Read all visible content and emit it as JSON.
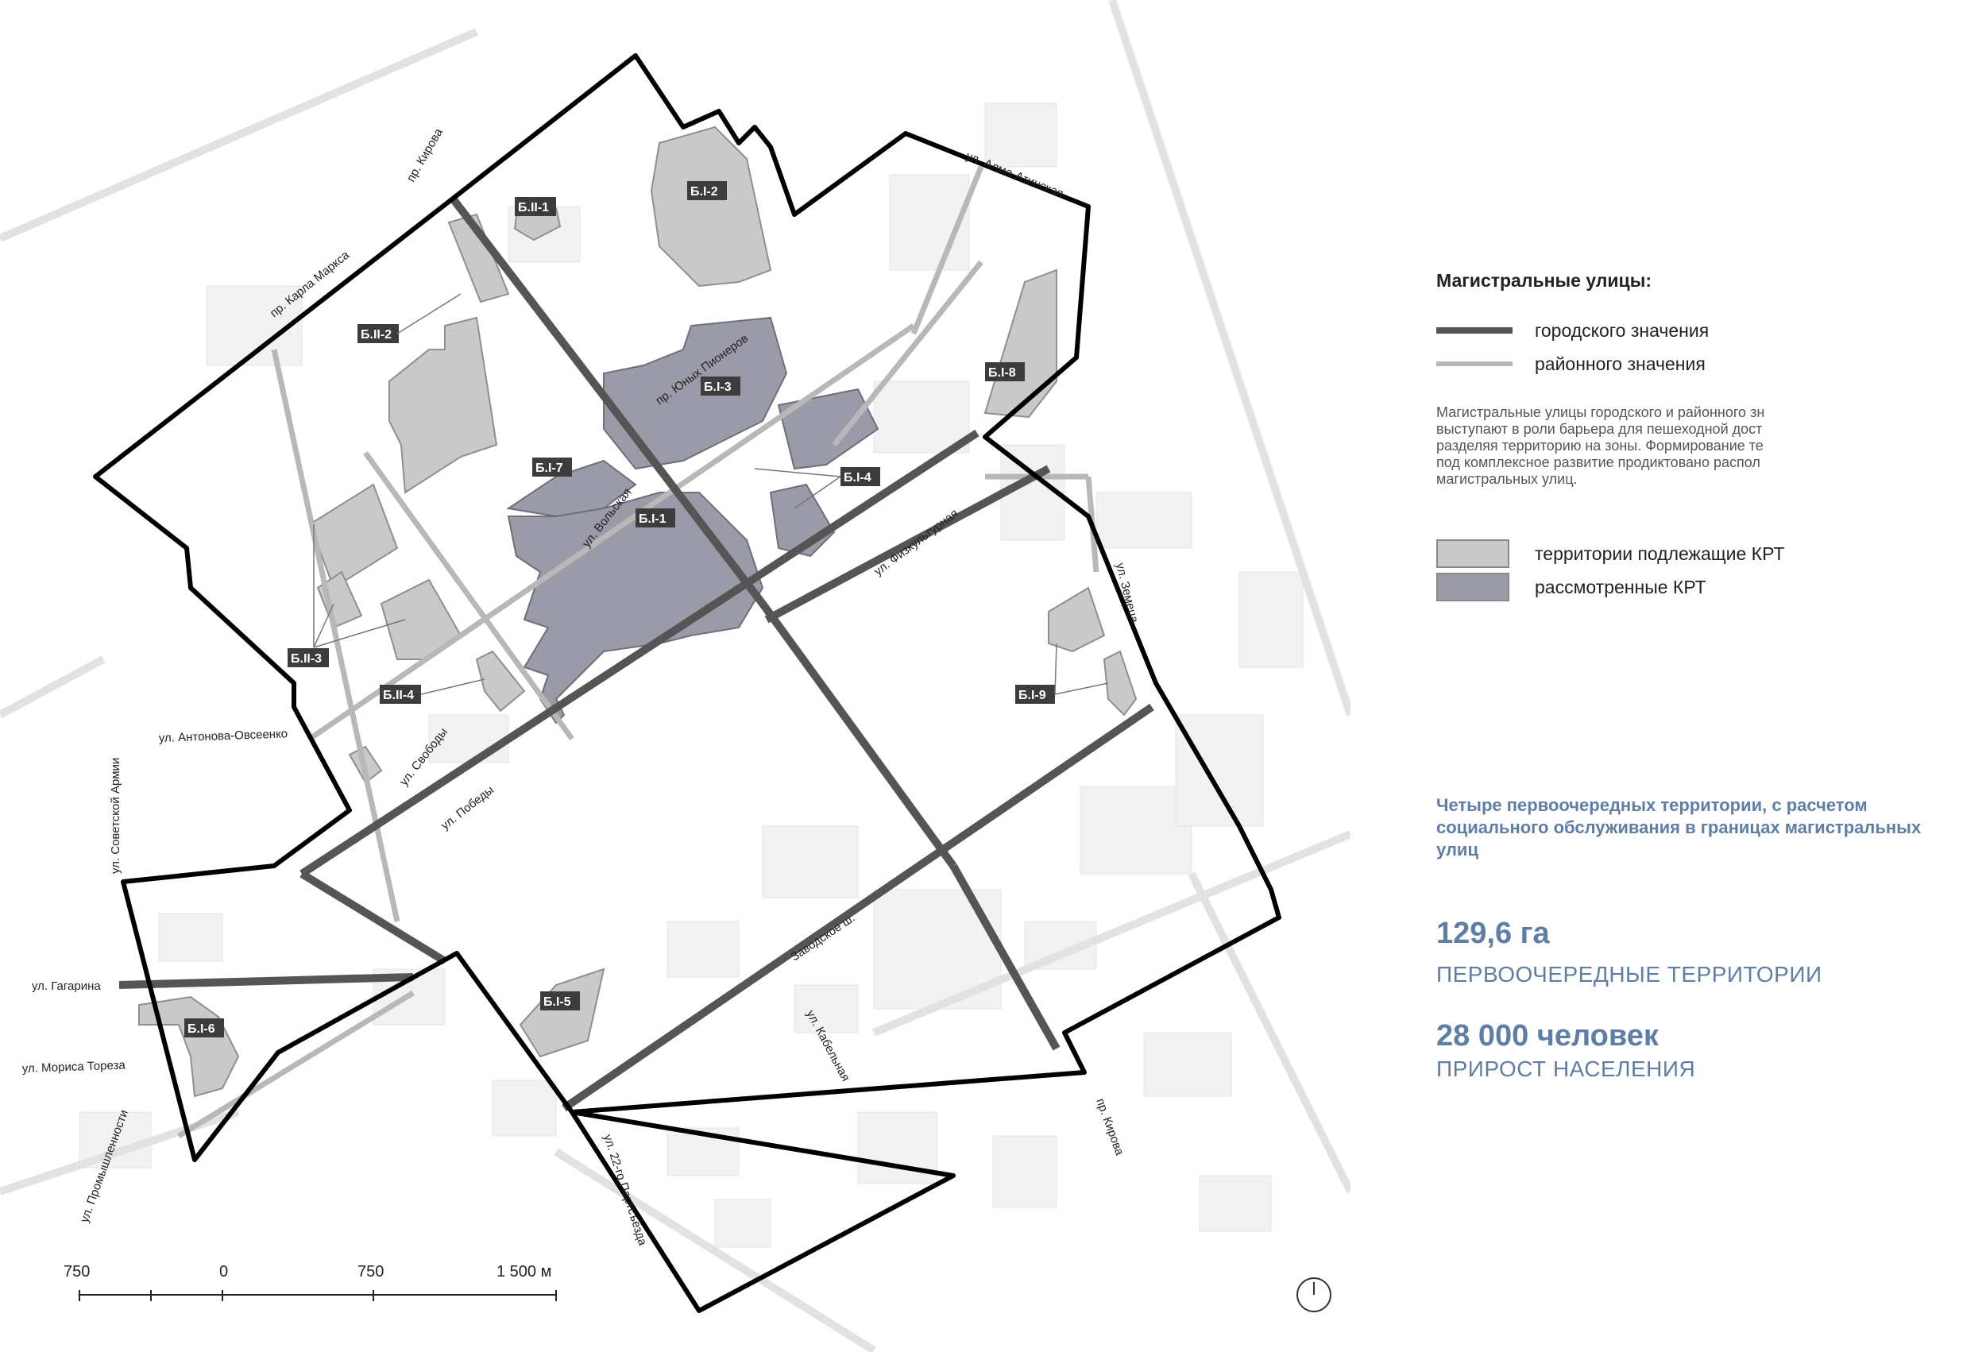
{
  "legend": {
    "title": "Магистральные улицы:",
    "items": [
      {
        "label": "городского значения",
        "color": "#555555"
      },
      {
        "label": "районного значения",
        "color": "#b8b8b8"
      }
    ],
    "description": [
      "Магистральные улицы городского и районного зн",
      "выступают в роли барьера для пешеходной дост",
      "разделяя территорию на зоны. Формирование те",
      "под комплексное развитие продиктовано распол",
      "магистральных улиц."
    ],
    "swatches": [
      {
        "label": "территории подлежащие КРТ",
        "color": "#c9c9c9"
      },
      {
        "label": "рассмотренные КРТ",
        "color": "#9a9aa8"
      }
    ]
  },
  "stats": {
    "lead": "Четыре первоочередных территории, с расчетом социального обслуживания в границах магистральных улиц",
    "area_value": "129,6 га",
    "area_caption": "ПЕРВООЧЕРЕДНЫЕ ТЕРРИТОРИИ",
    "pop_value": "28 000 человек",
    "pop_caption": "ПРИРОСТ НАСЕЛЕНИЯ"
  },
  "scale": {
    "labels": [
      "750",
      "0",
      "750",
      "1 500 м"
    ]
  },
  "streets": [
    "пр. Кирова",
    "пр. Карла Маркса",
    "ул. Алма-Атинская",
    "пр. Юных Пионеров",
    "ул. Вольская",
    "ул. Физкультурная",
    "ул. Земеца",
    "ул. Антонова-Овсеенко",
    "ул. Советской Армии",
    "ул. Свободы",
    "ул. Победы",
    "ул. Гагарина",
    "ул. Мориса Тореза",
    "ул. Промышленности",
    "Заводское ш.",
    "ул. Кабельная",
    "ул. 22-го Партсъезда",
    "пр. Кирова"
  ],
  "zones": [
    "Б.II-1",
    "Б.I-2",
    "Б.II-2",
    "Б.I-3",
    "Б.I-8",
    "Б.I-7",
    "Б.I-4",
    "Б.I-1",
    "Б.II-3",
    "Б.II-4",
    "Б.I-9",
    "Б.I-5",
    "Б.I-6"
  ],
  "colors": {
    "boundary": "#000000",
    "city_road": "#555555",
    "district_road": "#b8b8b8",
    "krt": "#c9c9c9",
    "considered": "#9a9aa8",
    "accent": "#5f7ea6"
  }
}
